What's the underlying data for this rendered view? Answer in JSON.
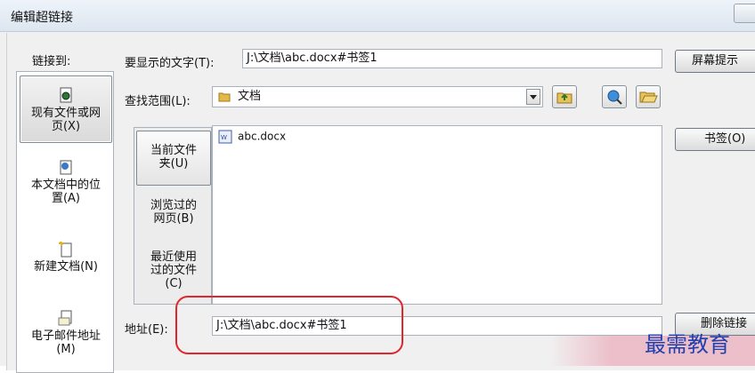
{
  "window": {
    "title": "编辑超链接"
  },
  "nav": {
    "header": "链接到:",
    "items": [
      {
        "label_line1": "现有文件或网",
        "label_line2": "页(X)"
      },
      {
        "label_line1": "本文档中的位",
        "label_line2": "置(A)"
      },
      {
        "label_line1": "新建文档(N)"
      },
      {
        "label_line1": "电子邮件地址",
        "label_line2": "(M)"
      }
    ]
  },
  "display_text": {
    "label": "要显示的文字(T):",
    "value": "J:\\文档\\abc.docx#书签1"
  },
  "screentip_button": "屏幕提示",
  "look_in": {
    "label": "查找范围(L):",
    "value": "文档"
  },
  "browse_tabs": [
    {
      "line1": "当前文件",
      "line2": "夹(U)"
    },
    {
      "line1": "浏览过的",
      "line2": "网页(B)"
    },
    {
      "line1": "最近使用",
      "line2": "过的文件",
      "line3": "(C)"
    }
  ],
  "files": [
    {
      "name": "abc.docx"
    }
  ],
  "bookmark_button": "书签(O)",
  "address": {
    "label": "地址(E):",
    "value": "J:\\文档\\abc.docx#书签1"
  },
  "remove_link_button": "删除链接",
  "watermark": "最需教育",
  "colors": {
    "highlight": "#e0262a",
    "watermark": "#2040b0"
  }
}
